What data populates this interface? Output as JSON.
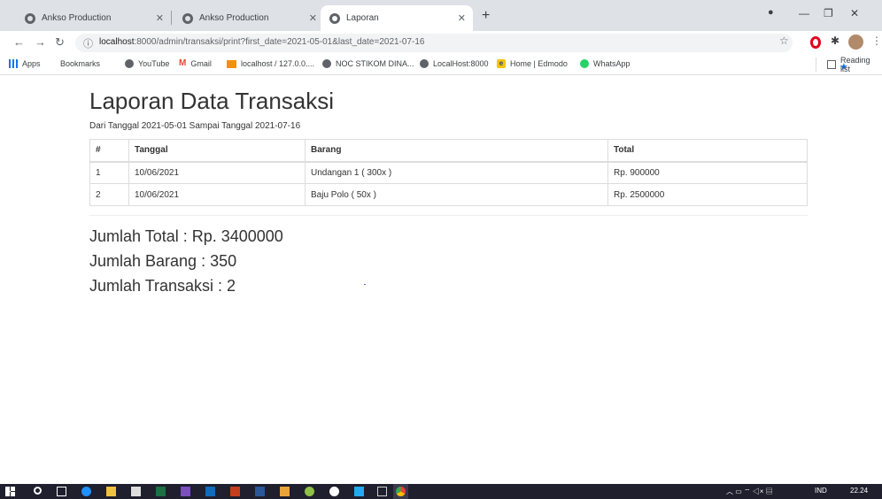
{
  "browser": {
    "tabs": [
      {
        "title": "Ankso Production",
        "active": false
      },
      {
        "title": "Ankso Production",
        "active": false
      },
      {
        "title": "Laporan",
        "active": true
      }
    ],
    "url_host": "localhost",
    "url_rest": ":8000/admin/transaksi/print?first_date=2021-05-01&last_date=2021-07-16",
    "bookmarks": [
      "Apps",
      "Bookmarks",
      "YouTube",
      "Gmail",
      "localhost / 127.0.0....",
      "NOC STIKOM DINA...",
      "LocalHost:8000",
      "Home | Edmodo",
      "WhatsApp"
    ],
    "reading_list": "Reading list"
  },
  "report": {
    "title": "Laporan Data Transaksi",
    "subtitle": "Dari Tanggal 2021-05-01 Sampai Tanggal 2021-07-16",
    "headers": [
      "#",
      "Tanggal",
      "Barang",
      "Total"
    ],
    "rows": [
      [
        "1",
        "10/06/2021",
        "Undangan 1 ( 300x )",
        "Rp. 900000"
      ],
      [
        "2",
        "10/06/2021",
        "Baju Polo ( 50x )",
        "Rp. 2500000"
      ]
    ],
    "summary": {
      "total": "Jumlah Total : Rp. 3400000",
      "barang": "Jumlah Barang : 350",
      "transaksi": "Jumlah Transaksi : 2"
    }
  },
  "taskbar": {
    "lang": "IND",
    "time": "22.24"
  }
}
